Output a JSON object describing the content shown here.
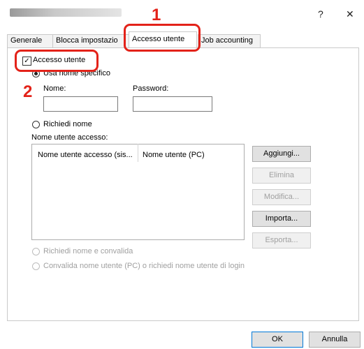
{
  "window": {
    "help_label": "?",
    "close_label": "✕"
  },
  "tabs": [
    "Generale",
    "Blocca impostazio",
    "Accesso utente",
    "Job accounting"
  ],
  "callouts": [
    "1",
    "2"
  ],
  "access": {
    "checkbox_label": "Accesso utente",
    "checked": true,
    "radio_specific": "Usa nome specifico",
    "name_label": "Nome:",
    "name_value": "",
    "password_label": "Password:",
    "password_value": "",
    "radio_request": "Richiedi nome",
    "list_label": "Nome utente accesso:",
    "columns": [
      "Nome utente accesso (sis...",
      "Nome utente (PC)"
    ],
    "radio_request_validate": "Richiedi nome e convalida",
    "radio_validate_pc": "Convalida nome utente (PC) o richiedi nome utente di login"
  },
  "side_buttons": {
    "add": "Aggiungi...",
    "delete": "Elimina",
    "edit": "Modifica...",
    "import": "Importa...",
    "export": "Esporta..."
  },
  "footer": {
    "ok": "OK",
    "cancel": "Annulla"
  },
  "colors": {
    "callout": "#e32219",
    "active_border": "#0078d7"
  }
}
